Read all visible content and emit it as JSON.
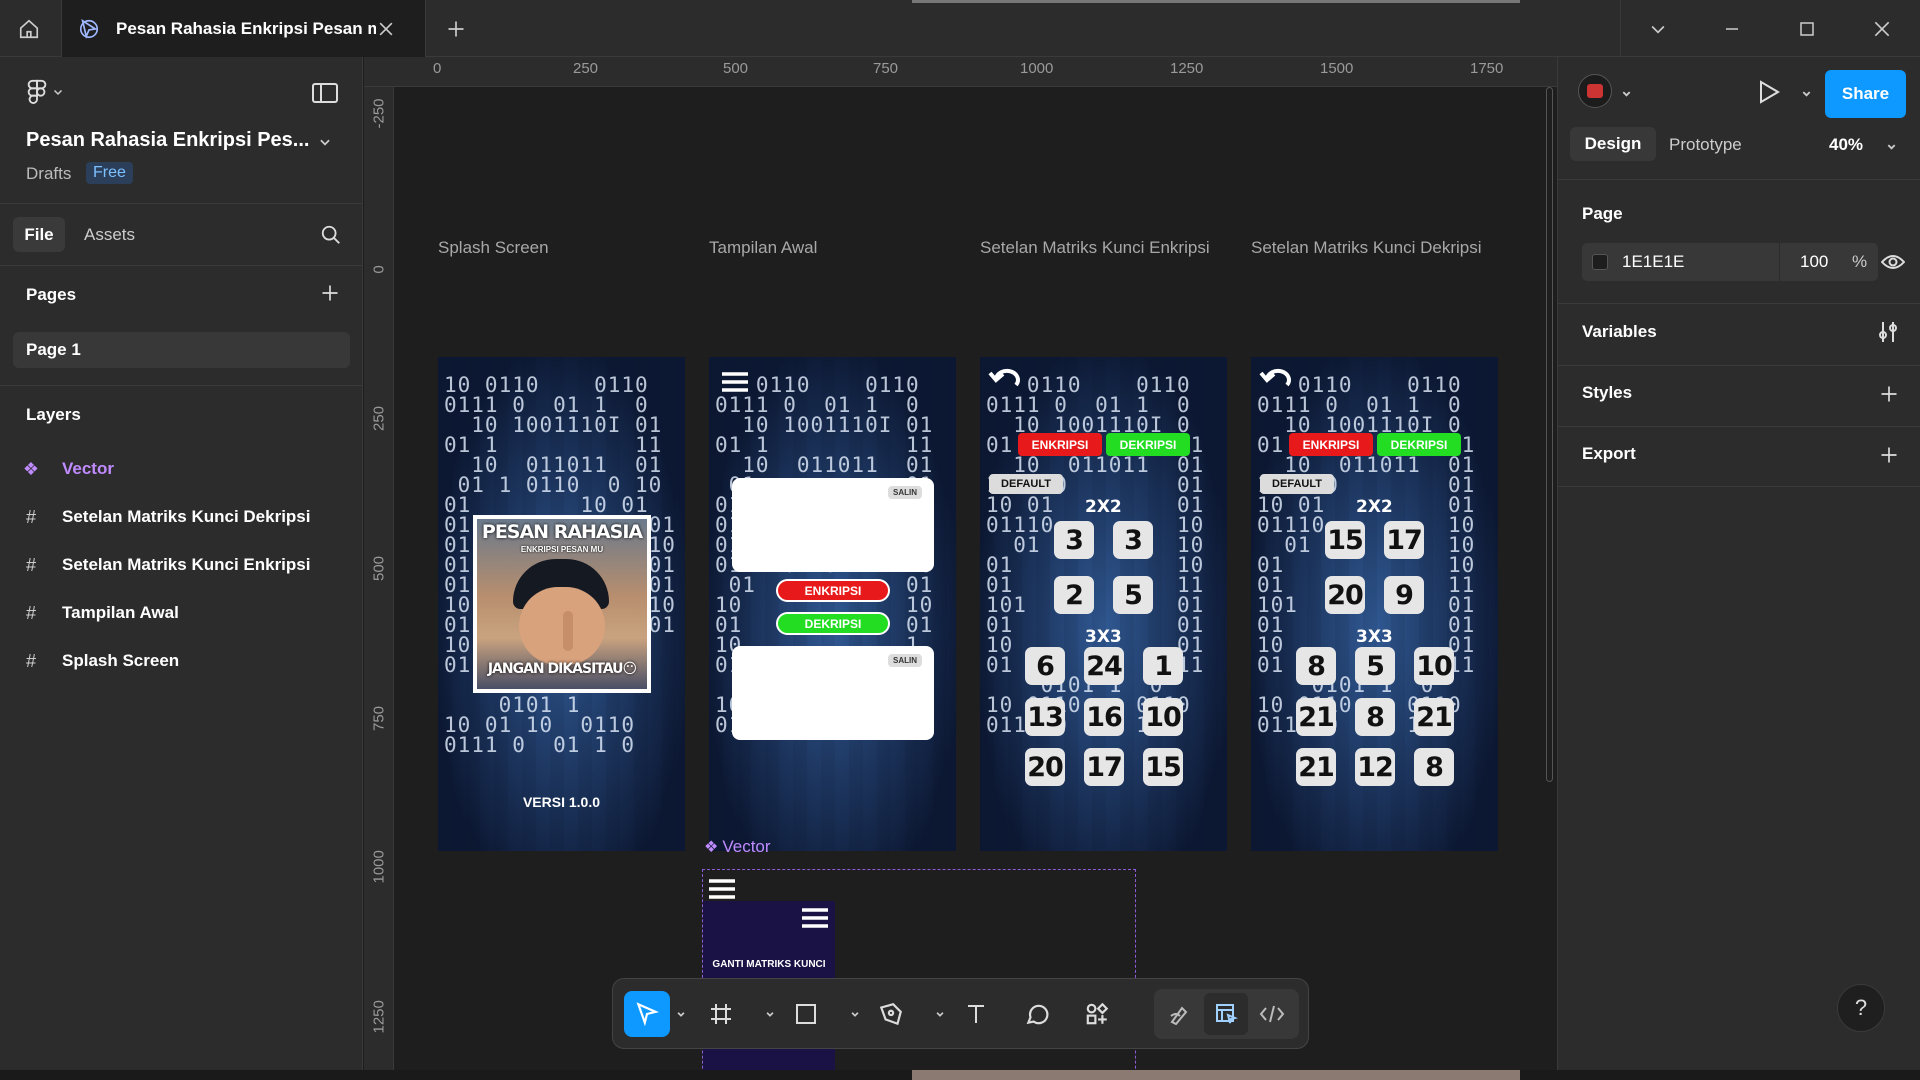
{
  "titlebar": {
    "tab_title": "Pesan Rahasia Enkripsi Pesan mu"
  },
  "left_panel": {
    "file_name": "Pesan Rahasia Enkripsi Pes...",
    "location": "Drafts",
    "plan_badge": "Free",
    "tab_file": "File",
    "tab_assets": "Assets",
    "pages_heading": "Pages",
    "current_page": "Page 1",
    "layers_heading": "Layers",
    "layers": [
      {
        "name": "Vector",
        "icon": "component-icon"
      },
      {
        "name": "Setelan Matriks Kunci Dekripsi",
        "icon": "frame-hash-icon"
      },
      {
        "name": "Setelan Matriks Kunci Enkripsi",
        "icon": "frame-hash-icon"
      },
      {
        "name": "Tampilan Awal",
        "icon": "frame-hash-icon"
      },
      {
        "name": "Splash Screen",
        "icon": "frame-hash-icon"
      }
    ]
  },
  "rulers": {
    "top": [
      "0",
      "250",
      "500",
      "750",
      "1000",
      "1250",
      "1500",
      "1750"
    ],
    "left": [
      "-250",
      "0",
      "250",
      "500",
      "750",
      "1000",
      "1250"
    ]
  },
  "canvas": {
    "frames": [
      {
        "label": "Splash Screen"
      },
      {
        "label": "Tampilan Awal"
      },
      {
        "label": "Setelan Matriks Kunci Enkripsi"
      },
      {
        "label": "Setelan Matriks Kunci Dekripsi"
      }
    ],
    "splash": {
      "title": "PESAN RAHASIA",
      "subtitle": "ENKRIPSI PESAN MU",
      "caption": "JANGAN DIKASITAU😶",
      "version": "VERSI 1.0.0"
    },
    "awal": {
      "copy_label": "SALIN",
      "encrypt_label": "ENKRIPSI",
      "decrypt_label": "DEKRIPSI"
    },
    "enkripsi": {
      "encrypt_label": "ENKRIPSI",
      "decrypt_label": "DEKRIPSI",
      "default_label": "DEFAULT",
      "label_2x2": "2X2",
      "label_3x3": "3X3",
      "matrix_2x2": [
        "3",
        "3",
        "2",
        "5"
      ],
      "matrix_3x3": [
        "6",
        "24",
        "1",
        "13",
        "16",
        "10",
        "20",
        "17",
        "15"
      ]
    },
    "dekripsi": {
      "encrypt_label": "ENKRIPSI",
      "decrypt_label": "DEKRIPSI",
      "default_label": "DEFAULT",
      "label_2x2": "2X2",
      "label_3x3": "3X3",
      "matrix_2x2": [
        "15",
        "17",
        "20",
        "9"
      ],
      "matrix_3x3": [
        "8",
        "5",
        "10",
        "21",
        "8",
        "21",
        "21",
        "12",
        "8"
      ]
    },
    "vector": {
      "label": "Vector",
      "menu_text": "GANTI MATRIKS KUNCI"
    }
  },
  "right_panel": {
    "tab_design": "Design",
    "tab_prototype": "Prototype",
    "zoom": "40%",
    "share_label": "Share",
    "page_heading": "Page",
    "page_color": "1E1E1E",
    "page_opacity": "100",
    "percent_sign": "%",
    "variables_heading": "Variables",
    "styles_heading": "Styles",
    "export_heading": "Export"
  },
  "colors": {
    "accent": "#0d99ff",
    "component": "#c08bff",
    "encrypt_red": "#e8191a",
    "decrypt_green": "#22dd22",
    "page_bg": "#1E1E1E"
  },
  "help_label": "?"
}
